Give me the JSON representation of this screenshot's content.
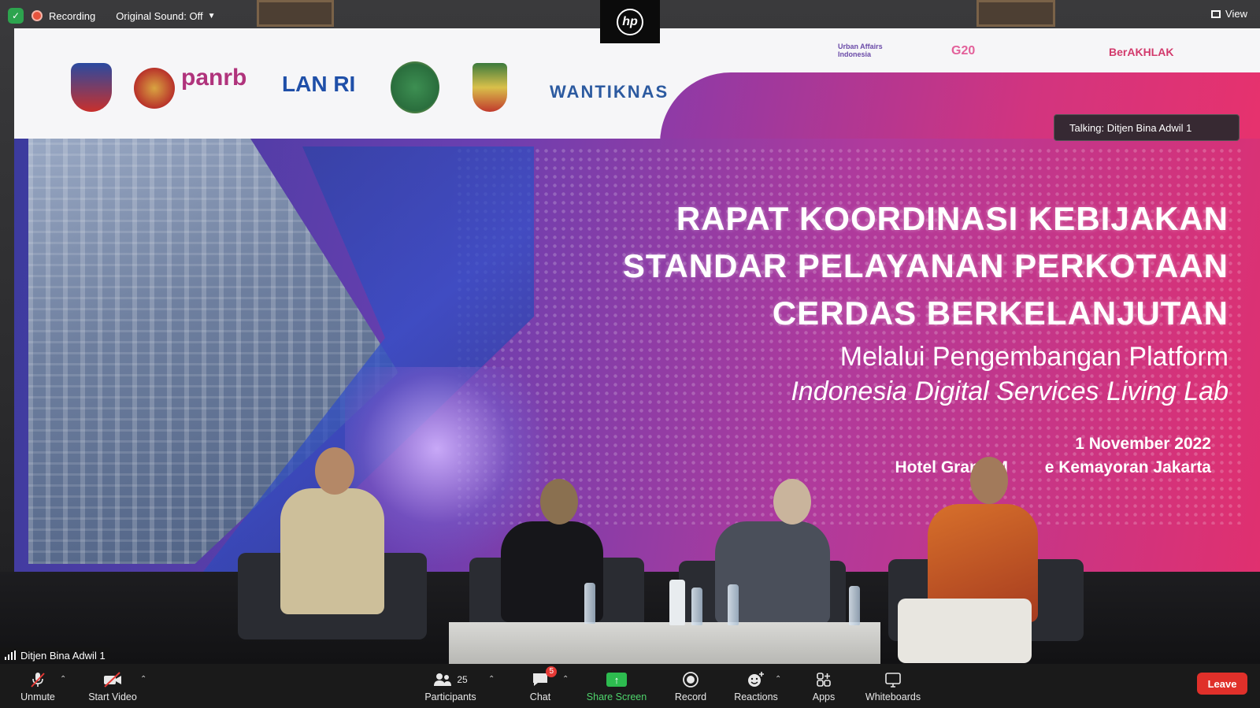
{
  "meeting": {
    "recording_label": "Recording",
    "original_sound": "Original Sound: Off",
    "view_label": "View",
    "talking_label": "Talking: Ditjen Bina Adwil 1",
    "speaker_name": "Ditjen Bina Adwil 1",
    "camera_logo": "hp"
  },
  "slide": {
    "logos": [
      "panrb",
      "LAN RI",
      "WANTIKNAS",
      "Urban Affairs Indonesia",
      "G20",
      "BerAKHLAK"
    ],
    "title_lines": [
      "RAPAT KOORDINASI KEBIJAKAN",
      "STANDAR PELAYANAN PERKOTAAN",
      "CERDAS BERKELANJUTAN"
    ],
    "subtitle_lines": [
      "Melalui Pengembangan Platform",
      "Indonesia Digital Services Living Lab"
    ],
    "date": "1 November 2022",
    "venue": "Hotel Grand M        e Kemayoran Jakarta"
  },
  "toolbar": {
    "unmute": "Unmute",
    "start_video": "Start Video",
    "participants": "Participants",
    "participants_count": "25",
    "chat": "Chat",
    "chat_badge": "5",
    "share_screen": "Share Screen",
    "record": "Record",
    "reactions": "Reactions",
    "apps": "Apps",
    "whiteboards": "Whiteboards",
    "leave": "Leave"
  },
  "colors": {
    "share_green": "#2dbb4f",
    "leave_red": "#e0302a",
    "slide_pink": "#e0306f",
    "slide_purple": "#6a3fb0"
  }
}
